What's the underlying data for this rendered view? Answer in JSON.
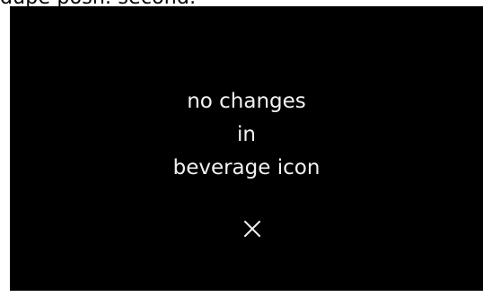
{
  "header_fragment": "dupe posh. second.",
  "dialog": {
    "message_lines": [
      "no changes",
      "in",
      "beverage icon"
    ],
    "close_glyph": "×"
  },
  "colors": {
    "screen_bg": "#000000",
    "text": "#f2f2f2",
    "page_bg": "#ffffff"
  },
  "icons": {
    "close": "close-icon"
  }
}
